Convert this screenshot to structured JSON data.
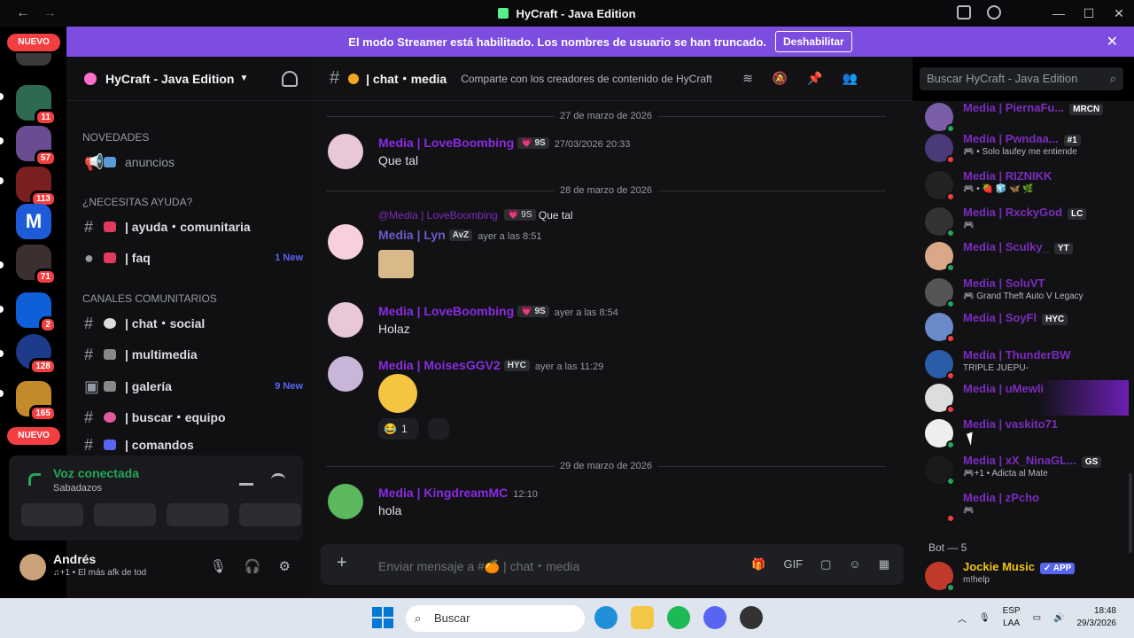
{
  "window": {
    "title": "HyCraft - Java Edition"
  },
  "banner": {
    "text": "El modo Streamer está habilitado. Los nombres de usuario se han truncado.",
    "button": "Deshabilitar"
  },
  "server_rail": {
    "nuevo_top": "NUEVO",
    "nuevo_bottom": "NUEVO",
    "badges": [
      "11",
      "57",
      "113",
      "71",
      "2",
      "128",
      "165"
    ]
  },
  "sidebar": {
    "server_name": "HyCraft - Java Edition",
    "categories": {
      "novedades": "NOVEDADES",
      "ayuda": "¿NECESITAS AYUDA?",
      "comunitarios": "CANALES COMUNITARIOS"
    },
    "channels": [
      {
        "name": "anuncios"
      },
      {
        "name": "| ayuda・comunitaria"
      },
      {
        "name": "| faq",
        "badge": "1 New"
      },
      {
        "name": "| chat・social"
      },
      {
        "name": "| multimedia"
      },
      {
        "name": "| galería",
        "badge": "9 New"
      },
      {
        "name": "| buscar・equipo"
      },
      {
        "name": "| comandos"
      }
    ],
    "voice": {
      "title": "Voz conectada",
      "channel": "Sabadazos"
    },
    "user": {
      "name": "Andrés",
      "status": "♫+1 • El más afk de tod"
    }
  },
  "chat": {
    "channel_name": "| chat・media",
    "topic": "Comparte con los creadores de contenido de HyCraft",
    "search_placeholder": "Buscar HyCraft - Java Edition",
    "composer_placeholder": "Enviar mensaje a #🍊 | chat・media",
    "dates": [
      "27 de marzo de 2026",
      "28 de marzo de 2026",
      "29 de marzo de 2026"
    ],
    "messages": [
      {
        "author": "Media | LoveBoombing",
        "tag": "💗 9S",
        "time": "27/03/2026 20:33",
        "text": "Que tal"
      },
      {
        "reply_author": "@Media | LoveBoombing",
        "reply_tag": "💗 9S",
        "reply_text": "Que tal",
        "author": "Media | Lyn",
        "tag": "AvZ",
        "time": "ayer a las 8:51",
        "text": ""
      },
      {
        "author": "Media | LoveBoombing",
        "tag": "💗 9S",
        "time": "ayer a las 8:54",
        "text": "Holaz"
      },
      {
        "author": "Media | MoisesGGV2",
        "tag": "HYC",
        "time": "ayer a las 11:29",
        "text": "",
        "reaction": "1"
      },
      {
        "author": "Media | KingdreamMC",
        "tag": "",
        "time": "12:10",
        "text": "hola"
      }
    ]
  },
  "members": [
    {
      "name": "Media | PiernaFu...",
      "tag": "MRCN",
      "activity": "",
      "status": "online"
    },
    {
      "name": "Media | Pwndaa...",
      "tag": "#1",
      "activity": "🎮 • Solo laufey me entiende",
      "status": "dnd"
    },
    {
      "name": "Media | RIZNIKK",
      "tag": "",
      "activity": "🎮 • 🍓 🧊 🦋 🌿",
      "status": "dnd"
    },
    {
      "name": "Media | RxckyGod",
      "tag": "LC",
      "activity": "🎮",
      "status": "online"
    },
    {
      "name": "Media | Sculky_",
      "tag": "YT",
      "activity": "",
      "status": "online"
    },
    {
      "name": "Media | SoluVT",
      "tag": "",
      "activity": "🎮 Grand Theft Auto V Legacy",
      "status": "online"
    },
    {
      "name": "Media | SoyFl",
      "tag": "HYC",
      "activity": "",
      "status": "dnd"
    },
    {
      "name": "Media | ThunderBW",
      "tag": "",
      "activity": "TRIPLE JUEPU-",
      "status": "dnd"
    },
    {
      "name": "Media | uMewli",
      "tag": "",
      "activity": "",
      "status": "dnd"
    },
    {
      "name": "Media | vaskito71",
      "tag": "",
      "activity": "",
      "status": "online"
    },
    {
      "name": "Media | xX_NinaGL...",
      "tag": "GS",
      "activity": "🎮+1 • Adicta al Mate",
      "status": "online"
    },
    {
      "name": "Media | zPcho",
      "tag": "",
      "activity": "🎮",
      "status": "dnd"
    }
  ],
  "bots": {
    "header": "Bot — 5",
    "first": {
      "name": "Jockie Music",
      "tag": "✓ APP",
      "activity": "m!help"
    }
  },
  "taskbar": {
    "search": "Buscar",
    "lang_top": "ESP",
    "lang_bottom": "LAA",
    "time": "18:48",
    "date": "29/3/2026"
  }
}
